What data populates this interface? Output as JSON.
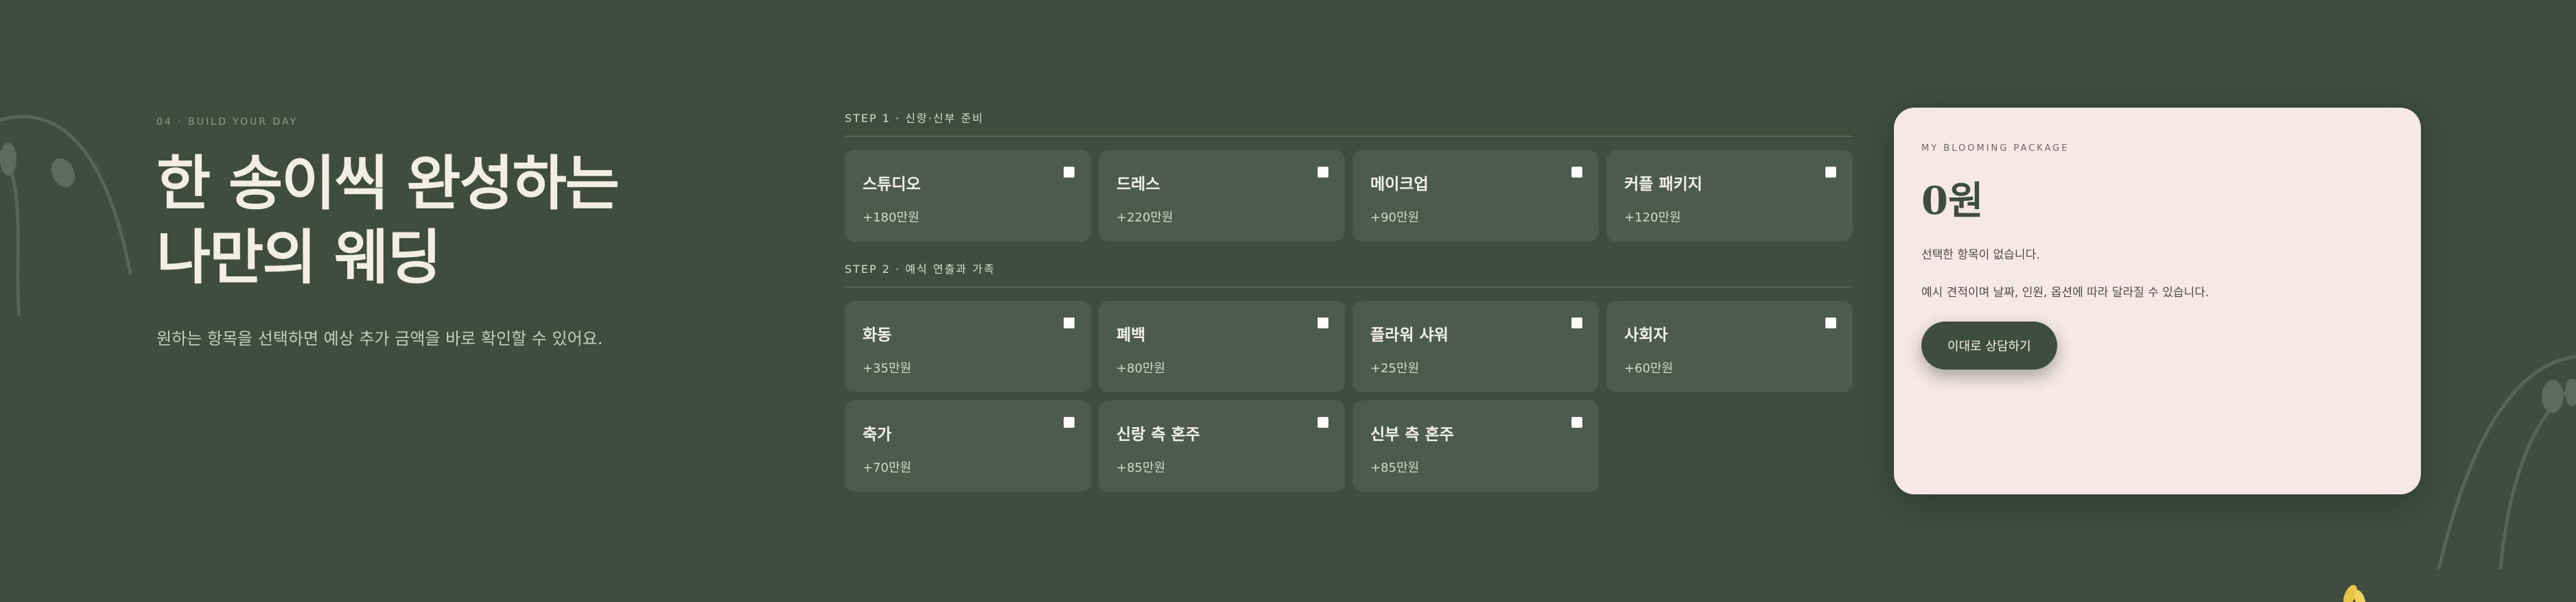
{
  "hero": {
    "eyebrow": "04 · BUILD YOUR DAY",
    "title_line1": "한 송이씩 완성하는",
    "title_line2": "나만의 웨딩",
    "description": "원하는 항목을 선택하면 예상 추가 금액을 바로 확인할 수 있어요."
  },
  "step1": {
    "label": "STEP 1 · 신랑·신부 준비",
    "items": [
      {
        "name": "스튜디오",
        "price": "+180만원",
        "checked": false
      },
      {
        "name": "드레스",
        "price": "+220만원",
        "checked": false
      },
      {
        "name": "메이크업",
        "price": "+90만원",
        "checked": false
      },
      {
        "name": "커플 패키지",
        "price": "+120만원",
        "checked": false
      }
    ]
  },
  "step2": {
    "label": "STEP 2 · 예식 연출과 가족",
    "items": [
      {
        "name": "화동",
        "price": "+35만원",
        "checked": false
      },
      {
        "name": "폐백",
        "price": "+80만원",
        "checked": false
      },
      {
        "name": "플라워 샤워",
        "price": "+25만원",
        "checked": false
      },
      {
        "name": "사회자",
        "price": "+60만원",
        "checked": false
      },
      {
        "name": "축가",
        "price": "+70만원",
        "checked": false
      },
      {
        "name": "신랑 측 혼주",
        "price": "+85만원",
        "checked": false
      },
      {
        "name": "신부 측 혼주",
        "price": "+85만원",
        "checked": false
      }
    ]
  },
  "package": {
    "eyebrow": "MY BLOOMING PACKAGE",
    "total": "0원",
    "empty_text": "선택한 항목이 없습니다.",
    "note": "예시 견적이며 날짜, 인원, 옵션에 따라 달라질 수 있습니다.",
    "button_label": "이대로 상담하기"
  },
  "colors": {
    "background": "#3e4d40",
    "card": "#4d5b4e",
    "panel": "#f5e8e5",
    "accent": "#3e4d40"
  }
}
